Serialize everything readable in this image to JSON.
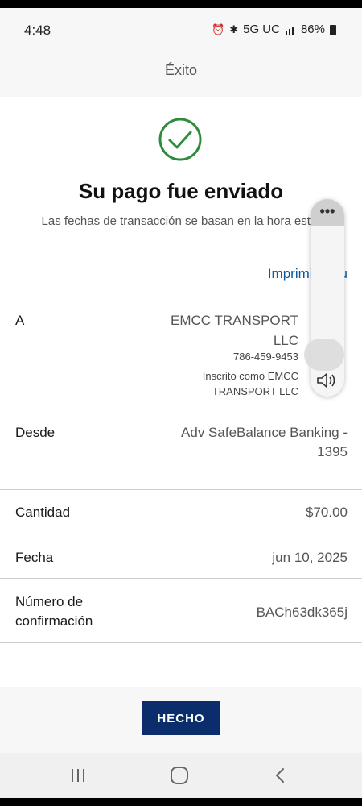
{
  "status_bar": {
    "time": "4:48",
    "network": "5G UC",
    "battery": "86%"
  },
  "header": {
    "title": "Éxito"
  },
  "confirmation": {
    "headline": "Su pago fue enviado",
    "subtext": "Las fechas de transacción se basan en la hora este.",
    "print_link": "Imprimir o gu"
  },
  "details": {
    "to": {
      "label": "A",
      "name": "EMCC TRANSPORT LLC",
      "phone": "786-459-9453",
      "note": "Inscrito como EMCC TRANSPORT LLC"
    },
    "from": {
      "label": "Desde",
      "value": "Adv SafeBalance Banking - 1395"
    },
    "amount": {
      "label": "Cantidad",
      "value": "$70.00"
    },
    "date": {
      "label": "Fecha",
      "value": "jun 10, 2025"
    },
    "confirmation_number": {
      "label": "Número de confirmación",
      "value": "BACh63dk365j"
    }
  },
  "actions": {
    "done": "HECHO"
  },
  "overlay": {
    "more": "•••"
  },
  "colors": {
    "success_green": "#2e8b3e",
    "link_blue": "#0a5aa0",
    "button_navy": "#0c2d6b"
  },
  "icons": {
    "status": [
      "alarm-icon",
      "bluetooth-icon",
      "signal-icon",
      "battery-icon"
    ],
    "nav": [
      "recents-icon",
      "home-icon",
      "back-icon"
    ]
  }
}
